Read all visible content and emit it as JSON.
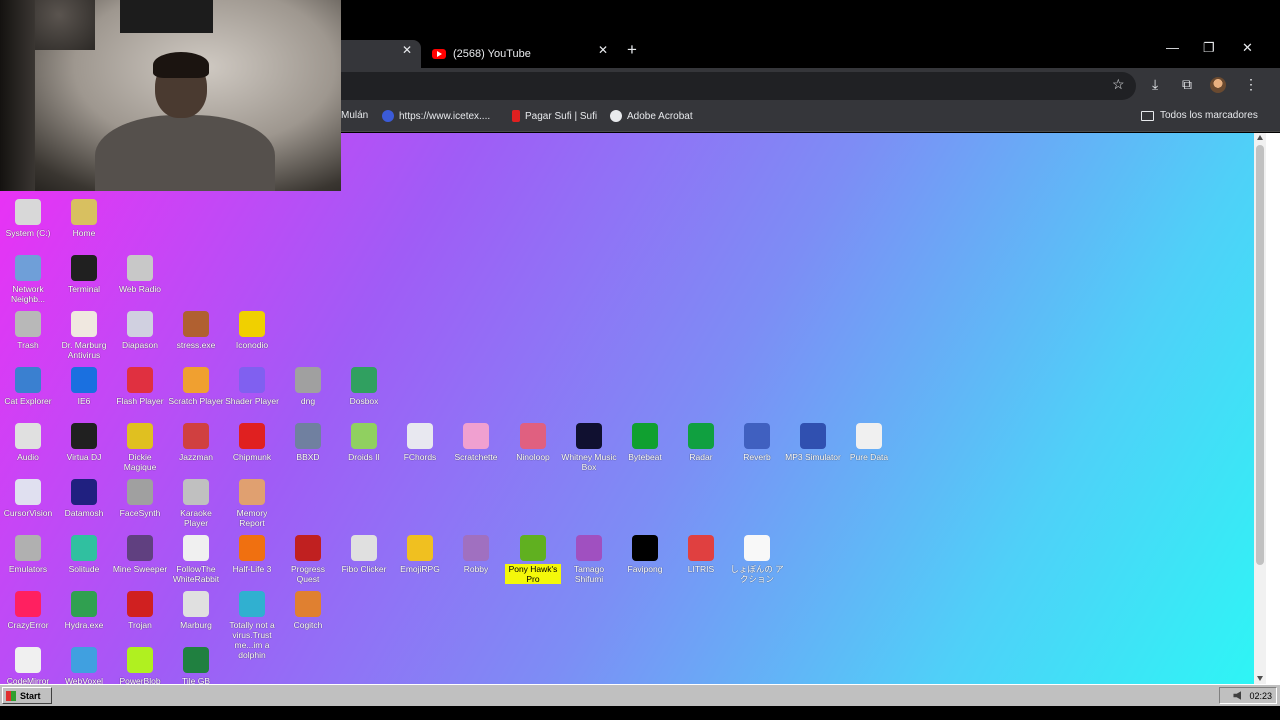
{
  "browser": {
    "tabs": [
      {
        "title": "",
        "active": true
      },
      {
        "title": "(2568) YouTube",
        "active": false
      }
    ],
    "bookmarks": [
      {
        "label": "Mulán",
        "icon": "bookmark-page-icon"
      },
      {
        "label": "https://www.icetex....",
        "icon": "icetex-icon"
      },
      {
        "label": "Pagar Sufi | Sufi",
        "icon": "sufi-icon"
      },
      {
        "label": "Adobe Acrobat",
        "icon": "acrobat-icon"
      }
    ],
    "all_bookmarks_label": "Todos los marcadores"
  },
  "desktop": {
    "icons": [
      {
        "id": "system-c",
        "label": "System (C:)",
        "color": "#d8d8d8"
      },
      {
        "id": "home",
        "label": "Home",
        "color": "#d8c060"
      },
      {
        "id": "network-neighborhood",
        "label": "Network Neighb...",
        "color": "#6f9fd8"
      },
      {
        "id": "terminal",
        "label": "Terminal",
        "color": "#202020"
      },
      {
        "id": "web-radio",
        "label": "Web Radio",
        "color": "#c8c8c8"
      },
      {
        "id": "trash",
        "label": "Trash",
        "color": "#b8b8b8"
      },
      {
        "id": "dr-marburg",
        "label": "Dr. Marburg Antivirus",
        "color": "#f0e8e0"
      },
      {
        "id": "diapason",
        "label": "Diapason",
        "color": "#d0d0e0"
      },
      {
        "id": "stress-exe",
        "label": "stress.exe",
        "color": "#b06030"
      },
      {
        "id": "iconodio",
        "label": "Iconodio",
        "color": "#f0d000"
      },
      {
        "id": "cat-explorer",
        "label": "Cat Explorer",
        "color": "#3a80d0"
      },
      {
        "id": "ie6",
        "label": "IE6",
        "color": "#1a70e0"
      },
      {
        "id": "flash-player",
        "label": "Flash Player",
        "color": "#e03040"
      },
      {
        "id": "scratch-player",
        "label": "Scratch Player",
        "color": "#f0a030"
      },
      {
        "id": "shader-player",
        "label": "Shader Player",
        "color": "#8060f0"
      },
      {
        "id": "dng",
        "label": "dng",
        "color": "#a0a0a0"
      },
      {
        "id": "dosbox",
        "label": "Dosbox",
        "color": "#30a060"
      },
      {
        "id": "audio",
        "label": "Audio",
        "color": "#e0e0e0"
      },
      {
        "id": "virtua-dj",
        "label": "Virtua DJ",
        "color": "#202020"
      },
      {
        "id": "dickie-magique",
        "label": "Dickie Magique",
        "color": "#e0c020"
      },
      {
        "id": "jazzman",
        "label": "Jazzman",
        "color": "#d04040"
      },
      {
        "id": "chipmunk",
        "label": "Chipmunk",
        "color": "#e02020"
      },
      {
        "id": "bbxd",
        "label": "BBXD",
        "color": "#7080a0"
      },
      {
        "id": "droids-ii",
        "label": "Droids II",
        "color": "#90d060"
      },
      {
        "id": "fchords",
        "label": "FChords",
        "color": "#e8e8f0"
      },
      {
        "id": "scratchette",
        "label": "Scratchette",
        "color": "#f0a0d0"
      },
      {
        "id": "ninoloop",
        "label": "Ninoloop",
        "color": "#e06080"
      },
      {
        "id": "whitney-music-box",
        "label": "Whitney Music Box",
        "color": "#101030"
      },
      {
        "id": "bytebeat",
        "label": "Bytebeat",
        "color": "#10a030"
      },
      {
        "id": "radar",
        "label": "Radar",
        "color": "#10a040"
      },
      {
        "id": "reverb",
        "label": "Reverb",
        "color": "#4060c0"
      },
      {
        "id": "mp3-simulator",
        "label": "MP3 Simulator",
        "color": "#3050b0"
      },
      {
        "id": "pure-data",
        "label": "Pure Data",
        "color": "#f0f0f0"
      },
      {
        "id": "cursorvision",
        "label": "CursorVision",
        "color": "#e0e0f0"
      },
      {
        "id": "datamosh",
        "label": "Datamosh",
        "color": "#202080"
      },
      {
        "id": "facesynth",
        "label": "FaceSynth",
        "color": "#a0a0a0"
      },
      {
        "id": "karaoke-player",
        "label": "Karaoke Player",
        "color": "#c0c0c0"
      },
      {
        "id": "memory-report",
        "label": "Memory Report",
        "color": "#e0a070"
      },
      {
        "id": "emulators",
        "label": "Emulators",
        "color": "#b0b0b0"
      },
      {
        "id": "solitude",
        "label": "Solitude",
        "color": "#30c0a0"
      },
      {
        "id": "mine-sweeper",
        "label": "Mine Sweeper",
        "color": "#604080"
      },
      {
        "id": "follow-the-white-rabbit",
        "label": "FollowThe WhiteRabbit",
        "color": "#f0f0f0"
      },
      {
        "id": "half-life-3",
        "label": "Half-Life 3",
        "color": "#f07010"
      },
      {
        "id": "progress-quest",
        "label": "Progress Quest",
        "color": "#c02020"
      },
      {
        "id": "fibo-clicker",
        "label": "Fibo Clicker",
        "color": "#e0e0e0"
      },
      {
        "id": "emojirpg",
        "label": "EmojiRPG",
        "color": "#f0c020"
      },
      {
        "id": "robby",
        "label": "Robby",
        "color": "#a070c0"
      },
      {
        "id": "pony-hawks-pro",
        "label": "Pony Hawk's Pro",
        "color": "#60b020",
        "highlight": true
      },
      {
        "id": "tamago-shifumi",
        "label": "Tamago Shifumi",
        "color": "#a050c0"
      },
      {
        "id": "favipong",
        "label": "Favipong",
        "color": "#000000"
      },
      {
        "id": "tetris",
        "label": "LITRIS",
        "color": "#e04040"
      },
      {
        "id": "shobon-action",
        "label": "しょぼんの アクション",
        "color": "#f8f8f8"
      },
      {
        "id": "crazyerror",
        "label": "CrazyError",
        "color": "#ff2060"
      },
      {
        "id": "hydra-exe",
        "label": "Hydra.exe",
        "color": "#30a050"
      },
      {
        "id": "trojan",
        "label": "Trojan",
        "color": "#d02020"
      },
      {
        "id": "marburg",
        "label": "Marburg",
        "color": "#e0e0e0"
      },
      {
        "id": "dolphin",
        "label": "Totally not a virus.Trust me...im a dolphin",
        "color": "#30b0d0"
      },
      {
        "id": "cogitch",
        "label": "Cogitch",
        "color": "#e08030"
      },
      {
        "id": "codemirror",
        "label": "CodeMirror",
        "color": "#f0f0f0"
      },
      {
        "id": "webvoxel",
        "label": "WebVoxel",
        "color": "#40a0e0"
      },
      {
        "id": "powerblob",
        "label": "PowerBlob",
        "color": "#b0f020"
      },
      {
        "id": "tile-gb",
        "label": "Tile GB",
        "color": "#208040"
      }
    ]
  },
  "taskbar": {
    "start_label": "Start",
    "clock": "02:23"
  }
}
